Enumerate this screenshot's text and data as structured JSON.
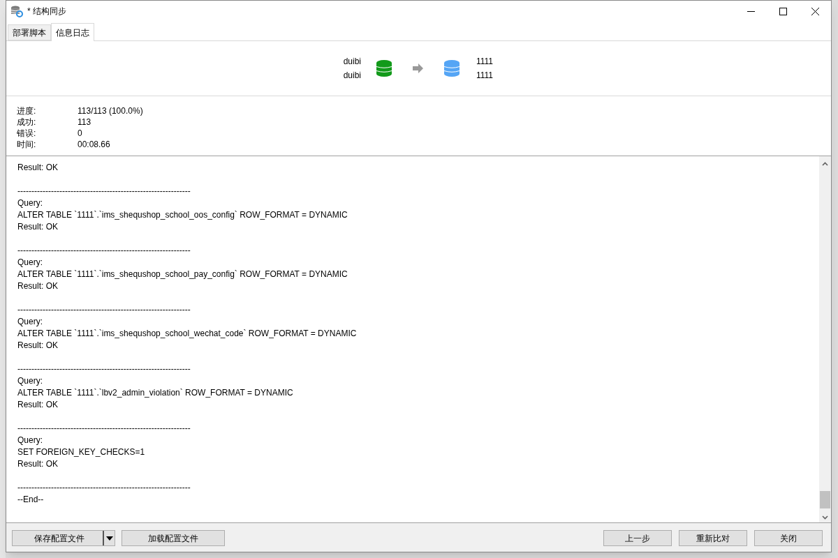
{
  "window": {
    "title": "* 结构同步"
  },
  "tabs": [
    {
      "label": "部署脚本",
      "selected": false
    },
    {
      "label": "信息日志",
      "selected": true
    }
  ],
  "connection": {
    "source": [
      "duibi",
      "duibi"
    ],
    "target": [
      "1111",
      "1111"
    ]
  },
  "stats": [
    {
      "label": "进度:",
      "value": "113/113 (100.0%)"
    },
    {
      "label": "成功:",
      "value": "113"
    },
    {
      "label": "错误:",
      "value": "0"
    },
    {
      "label": "时间:",
      "value": "00:08.66"
    }
  ],
  "log": [
    {
      "kind": "line",
      "text": "Result: OK"
    },
    {
      "kind": "gap"
    },
    {
      "kind": "line",
      "text": "--------------------------------------------------------------"
    },
    {
      "kind": "line",
      "text": "Query:"
    },
    {
      "kind": "line",
      "text": "ALTER TABLE `1111`.`ims_shequshop_school_oos_config` ROW_FORMAT = DYNAMIC"
    },
    {
      "kind": "line",
      "text": "Result: OK"
    },
    {
      "kind": "gap"
    },
    {
      "kind": "line",
      "text": "--------------------------------------------------------------"
    },
    {
      "kind": "line",
      "text": "Query:"
    },
    {
      "kind": "line",
      "text": "ALTER TABLE `1111`.`ims_shequshop_school_pay_config` ROW_FORMAT = DYNAMIC"
    },
    {
      "kind": "line",
      "text": "Result: OK"
    },
    {
      "kind": "gap"
    },
    {
      "kind": "line",
      "text": "--------------------------------------------------------------"
    },
    {
      "kind": "line",
      "text": "Query:"
    },
    {
      "kind": "line",
      "text": "ALTER TABLE `1111`.`ims_shequshop_school_wechat_code` ROW_FORMAT = DYNAMIC"
    },
    {
      "kind": "line",
      "text": "Result: OK"
    },
    {
      "kind": "gap"
    },
    {
      "kind": "line",
      "text": "--------------------------------------------------------------"
    },
    {
      "kind": "line",
      "text": "Query:"
    },
    {
      "kind": "line",
      "text": "ALTER TABLE `1111`.`lbv2_admin_violation` ROW_FORMAT = DYNAMIC"
    },
    {
      "kind": "line",
      "text": "Result: OK"
    },
    {
      "kind": "gap"
    },
    {
      "kind": "line",
      "text": "--------------------------------------------------------------"
    },
    {
      "kind": "line",
      "text": "Query:"
    },
    {
      "kind": "line",
      "text": "SET FOREIGN_KEY_CHECKS=1"
    },
    {
      "kind": "line",
      "text": "Result: OK"
    },
    {
      "kind": "gap"
    },
    {
      "kind": "line",
      "text": "--------------------------------------------------------------"
    },
    {
      "kind": "line",
      "text": "--End--"
    }
  ],
  "buttons_left": [
    {
      "label": "保存配置文件",
      "kind": "split"
    },
    {
      "label": "加载配置文件",
      "kind": "plain"
    }
  ],
  "buttons_right": [
    "上一步",
    "重新比对",
    "关闭"
  ]
}
